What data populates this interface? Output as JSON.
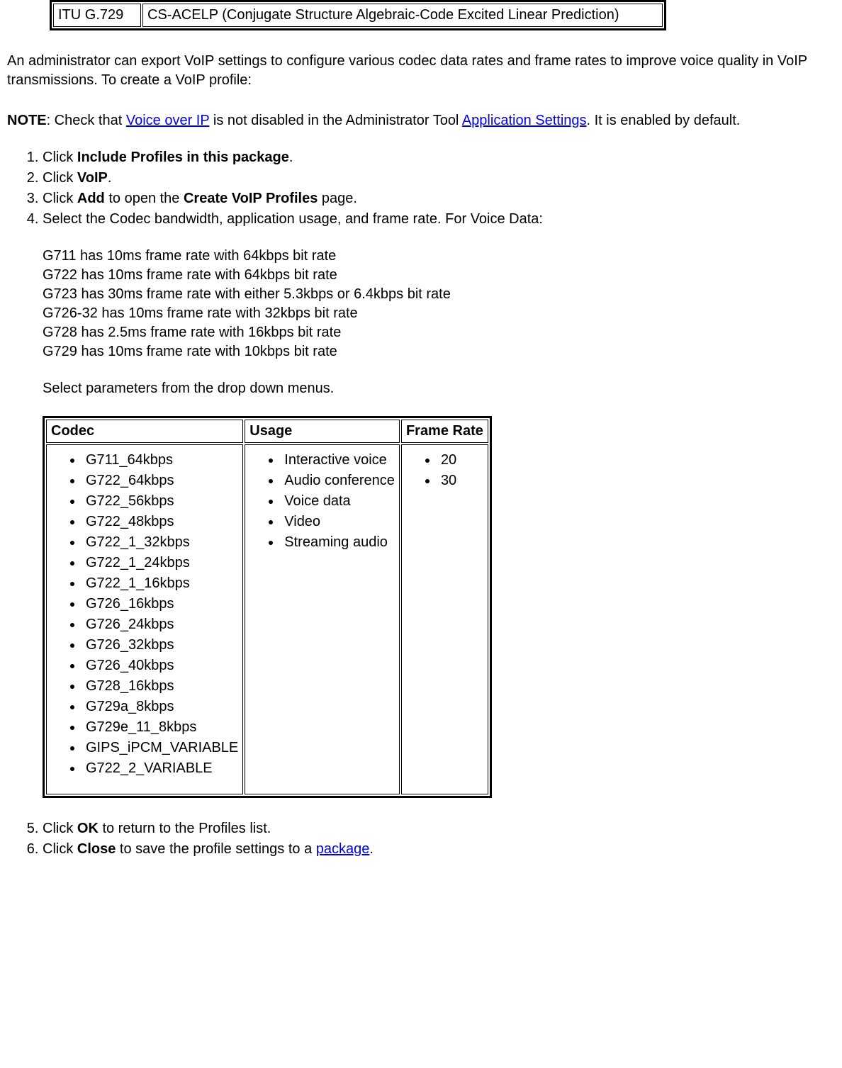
{
  "top_table": {
    "left": "ITU G.729",
    "right": "CS-ACELP (Conjugate Structure Algebraic-Code Excited Linear Prediction)"
  },
  "intro_para": "An administrator can export VoIP settings to configure various codec data rates and frame rates to improve voice quality in VoIP transmissions. To create a VoIP profile:",
  "note": {
    "label": "NOTE",
    "text1": ": Check that ",
    "link1": "Voice over IP",
    "text2": " is not disabled in the Administrator Tool ",
    "link2": "Application Settings",
    "text3": ". It is enabled by default."
  },
  "steps": {
    "s1a": "Click ",
    "s1b": "Include Profiles in this package",
    "s1c": ".",
    "s2a": "Click ",
    "s2b": "VoIP",
    "s2c": ".",
    "s3a": "Click ",
    "s3b": "Add",
    "s3c": " to open the ",
    "s3d": "Create VoIP Profiles",
    "s3e": " page.",
    "s4": "Select the Codec bandwidth, application usage, and frame rate. For Voice Data:",
    "s5a": "Click ",
    "s5b": "OK",
    "s5c": " to return to the Profiles list.",
    "s6a": "Click ",
    "s6b": "Close",
    "s6c": " to save the profile settings to a ",
    "s6link": "package",
    "s6d": "."
  },
  "codec_lines": [
    "G711 has 10ms frame rate with 64kbps bit rate",
    "G722 has 10ms frame rate with 64kbps bit rate",
    "G723 has 30ms frame rate with either 5.3kbps or 6.4kbps bit rate",
    "G726-32 has 10ms frame rate with 32kbps bit rate",
    "G728 has 2.5ms frame rate with 16kbps bit rate",
    "G729 has 10ms frame rate with 10kbps bit rate"
  ],
  "select_para": "Select parameters from the drop down menus.",
  "param_table": {
    "headers": {
      "c1": "Codec",
      "c2": "Usage",
      "c3": "Frame Rate"
    },
    "codec": [
      "G711_64kbps",
      "G722_64kbps",
      "G722_56kbps",
      "G722_48kbps",
      "G722_1_32kbps",
      "G722_1_24kbps",
      "G722_1_16kbps",
      "G726_16kbps",
      "G726_24kbps",
      "G726_32kbps",
      "G726_40kbps",
      "G728_16kbps",
      "G729a_8kbps",
      "G729e_11_8kbps",
      "GIPS_iPCM_VARIABLE",
      "G722_2_VARIABLE"
    ],
    "usage": [
      "Interactive voice",
      "Audio conference",
      "Voice data",
      "Video",
      "Streaming audio"
    ],
    "frame_rate": [
      "20",
      "30"
    ]
  }
}
